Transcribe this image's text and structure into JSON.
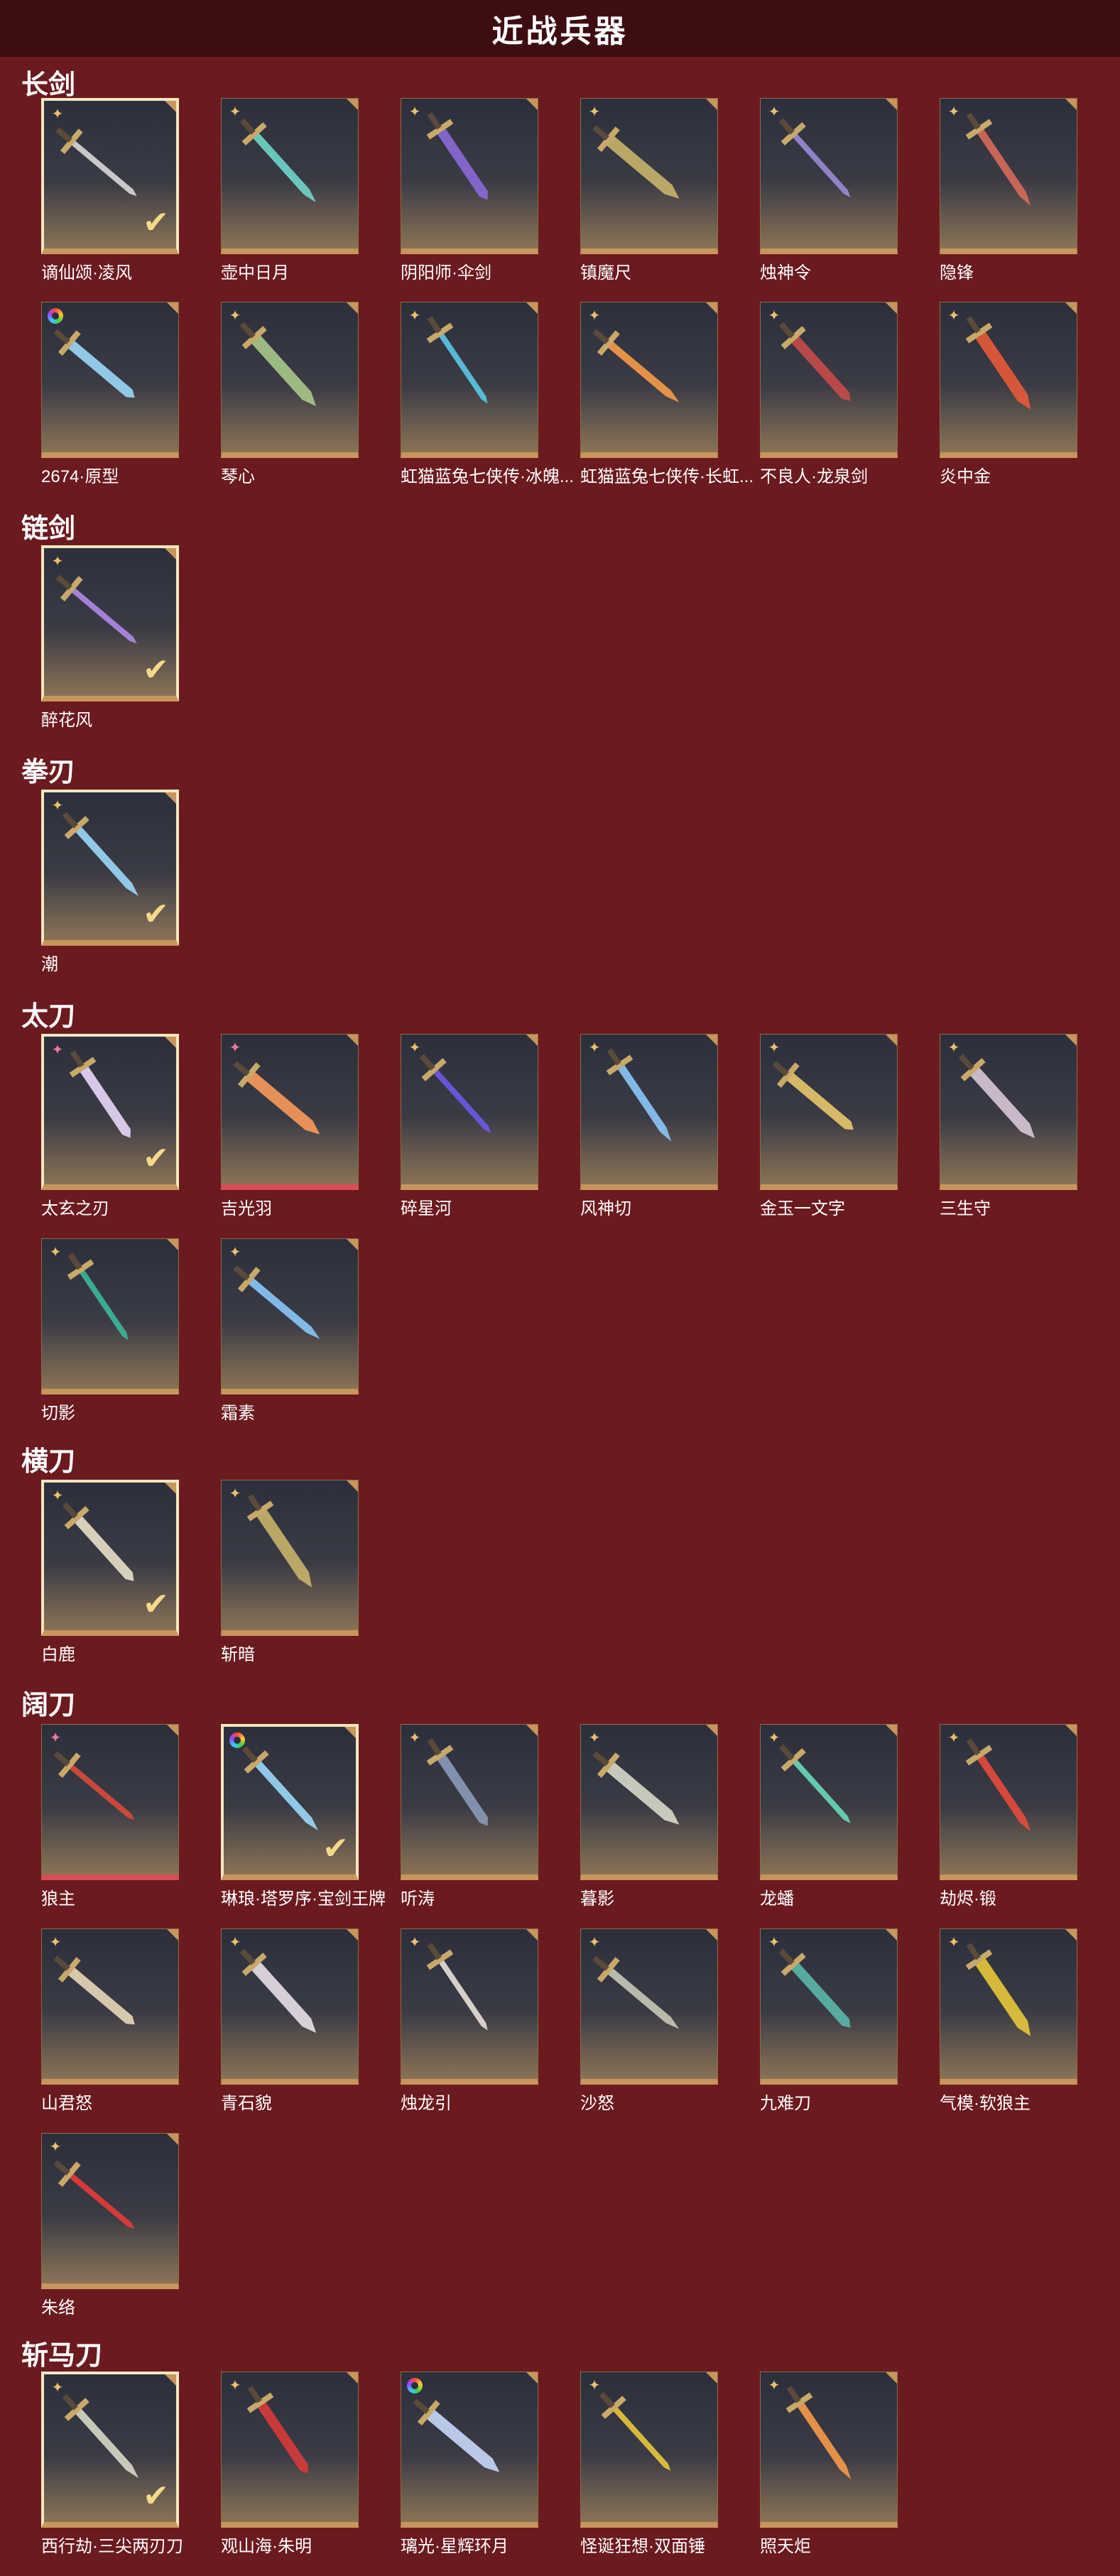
{
  "page": {
    "title": "近战兵器"
  },
  "sections": [
    {
      "name": "长剑",
      "items": [
        {
          "name": "谪仙颂·凌风",
          "rarity": "gold",
          "equipped": true,
          "color": "#d8d8d8"
        },
        {
          "name": "壶中日月",
          "rarity": "gold",
          "equipped": false,
          "color": "#6fd6c8"
        },
        {
          "name": "阴阳师·伞剑",
          "rarity": "gold",
          "equipped": false,
          "color": "#8a6ad8"
        },
        {
          "name": "镇魔尺",
          "rarity": "gold",
          "equipped": false,
          "color": "#c8b46a"
        },
        {
          "name": "烛神令",
          "rarity": "gold",
          "equipped": false,
          "color": "#9a8ad8"
        },
        {
          "name": "隐锋",
          "rarity": "gold",
          "equipped": false,
          "color": "#d86a5a"
        },
        {
          "name": "2674·原型",
          "rarity": "rainbow",
          "equipped": false,
          "color": "#9ad8f8"
        },
        {
          "name": "琴心",
          "rarity": "gold",
          "equipped": false,
          "color": "#a8c88a"
        },
        {
          "name": "虹猫蓝兔七侠传·冰魄...",
          "rarity": "gold",
          "equipped": false,
          "color": "#5ac8e8"
        },
        {
          "name": "虹猫蓝兔七侠传·长虹...",
          "rarity": "gold",
          "equipped": false,
          "color": "#f89a4a"
        },
        {
          "name": "不良人·龙泉剑",
          "rarity": "gold",
          "equipped": false,
          "color": "#c84a4a"
        },
        {
          "name": "炎中金",
          "rarity": "gold",
          "equipped": false,
          "color": "#e85a3a"
        }
      ]
    },
    {
      "name": "链剑",
      "items": [
        {
          "name": "醉花风",
          "rarity": "gold",
          "equipped": true,
          "color": "#b08ae8"
        }
      ]
    },
    {
      "name": "拳刃",
      "items": [
        {
          "name": "潮",
          "rarity": "gold",
          "equipped": true,
          "color": "#9ad8f8"
        }
      ]
    },
    {
      "name": "太刀",
      "items": [
        {
          "name": "太玄之刃",
          "rarity": "pink",
          "equipped": true,
          "color": "#e8d8f8"
        },
        {
          "name": "吉光羽",
          "rarity": "pink",
          "equipped": false,
          "color": "#f89a5a",
          "redBase": true
        },
        {
          "name": "碎星河",
          "rarity": "gold",
          "equipped": false,
          "color": "#6a5ae8"
        },
        {
          "name": "风神切",
          "rarity": "gold",
          "equipped": false,
          "color": "#8ac8f8"
        },
        {
          "name": "金玉一文字",
          "rarity": "gold",
          "equipped": false,
          "color": "#e8c86a"
        },
        {
          "name": "三生守",
          "rarity": "gold",
          "equipped": false,
          "color": "#d8c8d8"
        },
        {
          "name": "切影",
          "rarity": "gold",
          "equipped": false,
          "color": "#3ab89a"
        },
        {
          "name": "霜素",
          "rarity": "gold",
          "equipped": false,
          "color": "#8ac8f8"
        }
      ]
    },
    {
      "name": "横刀",
      "items": [
        {
          "name": "白鹿",
          "rarity": "gold",
          "equipped": true,
          "color": "#e8e0c8"
        },
        {
          "name": "斩暗",
          "rarity": "gold",
          "equipped": false,
          "color": "#c8b46a"
        }
      ]
    },
    {
      "name": "阔刀",
      "items": [
        {
          "name": "狼主",
          "rarity": "pink",
          "equipped": false,
          "color": "#d84a3a",
          "redBase": true
        },
        {
          "name": "琳琅·塔罗序·宝剑王牌",
          "rarity": "rainbow",
          "equipped": true,
          "color": "#9ad8f8"
        },
        {
          "name": "听涛",
          "rarity": "gold",
          "equipped": false,
          "color": "#8a9ab8"
        },
        {
          "name": "暮影",
          "rarity": "gold",
          "equipped": false,
          "color": "#d8d8c8"
        },
        {
          "name": "龙蟠",
          "rarity": "gold",
          "equipped": false,
          "color": "#6ad8b8"
        },
        {
          "name": "劫烬·锻",
          "rarity": "gold",
          "equipped": false,
          "color": "#e84a3a"
        },
        {
          "name": "山君怒",
          "rarity": "gold",
          "equipped": false,
          "color": "#e8d8b8"
        },
        {
          "name": "青石貌",
          "rarity": "gold",
          "equipped": false,
          "color": "#e8e0e8"
        },
        {
          "name": "烛龙引",
          "rarity": "gold",
          "equipped": false,
          "color": "#e8e0d8"
        },
        {
          "name": "沙怒",
          "rarity": "gold",
          "equipped": false,
          "color": "#c8c8b8"
        },
        {
          "name": "九难刀",
          "rarity": "gold",
          "equipped": false,
          "color": "#5ab8a8"
        },
        {
          "name": "气模·软狼主",
          "rarity": "gold",
          "equipped": false,
          "color": "#e8c83a"
        },
        {
          "name": "朱络",
          "rarity": "gold",
          "equipped": false,
          "color": "#e83a3a"
        }
      ]
    },
    {
      "name": "斩马刀",
      "items": [
        {
          "name": "西行劫·三尖两刃刀",
          "rarity": "gold",
          "equipped": true,
          "color": "#d8d8c8"
        },
        {
          "name": "观山海·朱明",
          "rarity": "gold",
          "equipped": false,
          "color": "#d83a3a"
        },
        {
          "name": "璃光·星辉环月",
          "rarity": "rainbow",
          "equipped": false,
          "color": "#c8d8f8"
        },
        {
          "name": "怪诞狂想·双面锤",
          "rarity": "gold",
          "equipped": false,
          "color": "#e8c83a"
        },
        {
          "name": "照天炬",
          "rarity": "gold",
          "equipped": false,
          "color": "#f89a4a"
        }
      ]
    }
  ]
}
